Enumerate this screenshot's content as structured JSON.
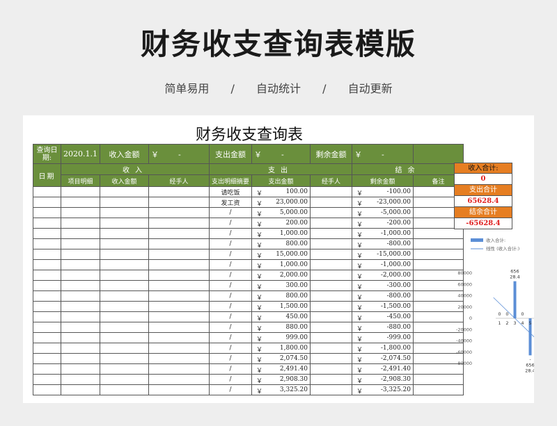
{
  "poster": {
    "title": "财务收支查询表模版",
    "tags": [
      "简单易用",
      "/",
      "自动统计",
      "/",
      "自动更新"
    ]
  },
  "sheet": {
    "title": "财务收支查询表",
    "header": {
      "query_date_label": "查询日期:",
      "query_date": "2020.1.1",
      "income_label": "收入金额",
      "income_value": "￥        -",
      "expense_label": "支出金额",
      "expense_value": "￥        -",
      "balance_label": "剩余金额",
      "balance_value": "￥        -"
    },
    "sections": {
      "date": "日期",
      "income": "收入",
      "expense": "支出",
      "balance": "结余"
    },
    "columns": [
      "项目明细",
      "收入金额",
      "经手人",
      "支出明细摘要",
      "支出金额",
      "经手人",
      "剩余金额",
      "备注"
    ],
    "currency": "￥",
    "rows": [
      {
        "summary": "请吃饭",
        "expense": "100.00",
        "balance": "-100.00"
      },
      {
        "summary": "发工资",
        "expense": "23,000.00",
        "balance": "-23,000.00"
      },
      {
        "summary": "/",
        "expense": "5,000.00",
        "balance": "-5,000.00"
      },
      {
        "summary": "/",
        "expense": "200.00",
        "balance": "-200.00"
      },
      {
        "summary": "/",
        "expense": "1,000.00",
        "balance": "-1,000.00"
      },
      {
        "summary": "/",
        "expense": "800.00",
        "balance": "-800.00"
      },
      {
        "summary": "/",
        "expense": "15,000.00",
        "balance": "-15,000.00"
      },
      {
        "summary": "/",
        "expense": "1,000.00",
        "balance": "-1,000.00"
      },
      {
        "summary": "/",
        "expense": "2,000.00",
        "balance": "-2,000.00"
      },
      {
        "summary": "/",
        "expense": "300.00",
        "balance": "-300.00"
      },
      {
        "summary": "/",
        "expense": "800.00",
        "balance": "-800.00"
      },
      {
        "summary": "/",
        "expense": "1,500.00",
        "balance": "-1,500.00"
      },
      {
        "summary": "/",
        "expense": "450.00",
        "balance": "-450.00"
      },
      {
        "summary": "/",
        "expense": "880.00",
        "balance": "-880.00"
      },
      {
        "summary": "/",
        "expense": "999.00",
        "balance": "-999.00"
      },
      {
        "summary": "/",
        "expense": "1,800.00",
        "balance": "-1,800.00"
      },
      {
        "summary": "/",
        "expense": "2,074.50",
        "balance": "-2,074.50"
      },
      {
        "summary": "/",
        "expense": "2,491.40",
        "balance": "-2,491.40"
      },
      {
        "summary": "/",
        "expense": "2,908.30",
        "balance": "-2,908.30"
      },
      {
        "summary": "/",
        "expense": "3,325.20",
        "balance": "-3,325.20"
      }
    ],
    "summary": {
      "income_total_label": "收入合计:",
      "income_total": "0",
      "expense_total_label": "支出合计",
      "expense_total": "65628.4",
      "balance_total_label": "结余合计",
      "balance_total": "-65628.4"
    }
  },
  "chart_data": {
    "type": "bar",
    "legend": [
      "收入合计:",
      "线性 (收入合计:)"
    ],
    "categories": [
      "1",
      "2",
      "3",
      "4",
      "5"
    ],
    "values": [
      0,
      0,
      65628.4,
      0,
      -65628.4
    ],
    "data_labels": [
      "0",
      "0",
      "656\n28.4",
      "0",
      "-\n656\n28.4"
    ],
    "ylim": [
      -80000,
      80000
    ],
    "yticks": [
      "80000",
      "60000",
      "40000",
      "20000",
      "0",
      "-20000",
      "-40000",
      "-60000",
      "-80000"
    ],
    "bar_color": "#5b8ed6",
    "trend_color": "#5b8ed6"
  }
}
